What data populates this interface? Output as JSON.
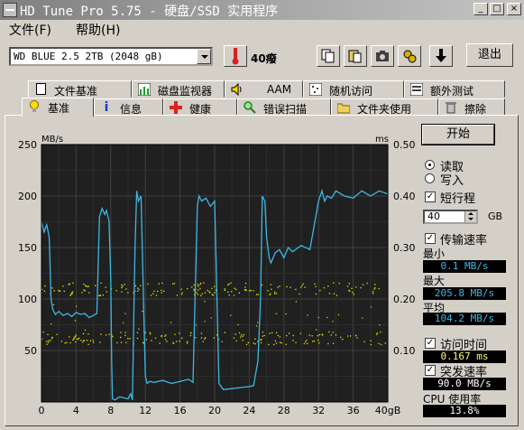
{
  "window": {
    "title": "HD Tune Pro 5.75 - 硬盘/SSD 实用程序",
    "minimize": "_",
    "maximize": "□",
    "close": "×"
  },
  "menu": {
    "file": "文件(F)",
    "help": "帮助(H)"
  },
  "toolbar": {
    "drive": "WD BLUE 2.5  2TB (2048 gB)",
    "temperature": "40癈",
    "exit": "退出"
  },
  "tabs_top": [
    {
      "label": "文件基准",
      "icon": "document-icon"
    },
    {
      "label": "磁盘监视器",
      "icon": "monitor-chart-icon"
    },
    {
      "label": "AAM",
      "icon": "speaker-icon"
    },
    {
      "label": "随机访问",
      "icon": "random-access-icon"
    },
    {
      "label": "额外测试",
      "icon": "extra-tests-icon"
    }
  ],
  "tabs_bottom": [
    {
      "label": "基准",
      "icon": "lightbulb-icon"
    },
    {
      "label": "信息",
      "icon": "info-icon"
    },
    {
      "label": "健康",
      "icon": "health-cross-icon"
    },
    {
      "label": "错误扫描",
      "icon": "magnifier-icon"
    },
    {
      "label": "文件夹使用",
      "icon": "folder-icon"
    },
    {
      "label": "擦除",
      "icon": "trash-icon"
    }
  ],
  "side": {
    "start": "开始",
    "read": "读取",
    "write": "写入",
    "short_stroke": "短行程",
    "short_stroke_value": "40",
    "short_stroke_unit": "GB",
    "transfer_rate": "传输速率",
    "min_label": "最小",
    "min_value": "0.1 MB/s",
    "max_label": "最大",
    "max_value": "205.8 MB/s",
    "avg_label": "平均",
    "avg_value": "104.2 MB/s",
    "access_time": "访问时间",
    "access_value": "0.167 ms",
    "burst_rate": "突发速率",
    "burst_value": "90.0 MB/s",
    "cpu_label": "CPU 使用率",
    "cpu_value": "13.8%"
  },
  "colors": {
    "transfer_line": "#3fb7e6",
    "access_dots": "#e8e800",
    "chart_bg": "#202020",
    "grid": "#404040",
    "value_text": "#ffff80"
  },
  "chart_data": {
    "type": "line",
    "y_left_label": "MB/s",
    "y_right_label": "ms",
    "y_left_ticks": [
      "50",
      "100",
      "150",
      "200",
      "250"
    ],
    "y_right_ticks": [
      "0.10",
      "0.20",
      "0.30",
      "0.40",
      "0.50"
    ],
    "x_ticks": [
      "0",
      "4",
      "8",
      "12",
      "16",
      "20",
      "24",
      "28",
      "32",
      "36",
      "40gB"
    ],
    "xlim": [
      0,
      40
    ],
    "ylim_left": [
      0,
      250
    ],
    "ylim_right": [
      0,
      0.5
    ],
    "series": [
      {
        "x": [
          0,
          0.3,
          0.6,
          0.9,
          1.1,
          1.3,
          1.6,
          2.0,
          2.5,
          3.0,
          3.5,
          4.0,
          4.5,
          5.0,
          5.5,
          6.0,
          6.4,
          6.7,
          7.0,
          7.3,
          7.5,
          7.8,
          8.0,
          8.1,
          8.2,
          8.5,
          9.0,
          9.5,
          10.0,
          10.3,
          10.5,
          10.8,
          11.0,
          11.2,
          11.5,
          11.8,
          12.0,
          12.2,
          12.5,
          13.0,
          14.0,
          15.0,
          16.0,
          17.0,
          17.5,
          18.0,
          18.2,
          18.5,
          19.0,
          19.5,
          20.0,
          20.5,
          21.0,
          22.0,
          23.0,
          24.0,
          24.5,
          25.0,
          25.3,
          25.5,
          25.8,
          26.0,
          26.3,
          26.5,
          27.0,
          27.5,
          28.0,
          28.5,
          29.0,
          30.0,
          31.0,
          32.0,
          32.4,
          32.7,
          33.0,
          33.5,
          34.0,
          35.0,
          36.0,
          37.0,
          38.0,
          39.0,
          40.0
        ],
        "y": [
          175,
          165,
          172,
          160,
          100,
          90,
          85,
          88,
          84,
          86,
          83,
          87,
          85,
          86,
          82,
          84,
          86,
          180,
          188,
          182,
          186,
          176,
          120,
          40,
          3,
          2,
          5,
          4,
          3,
          8,
          2,
          150,
          205,
          195,
          200,
          92,
          25,
          18,
          20,
          19,
          21,
          18,
          20,
          22,
          19,
          190,
          200,
          195,
          198,
          190,
          195,
          18,
          12,
          13,
          14,
          15,
          16,
          40,
          100,
          200,
          195,
          160,
          140,
          135,
          145,
          148,
          140,
          150,
          146,
          152,
          148,
          195,
          205,
          195,
          200,
          198,
          205,
          200,
          198,
          205,
          200,
          205,
          202
        ]
      }
    ],
    "access_time_bands_ms": [
      0.22,
      0.125
    ],
    "access_time_min_label": "0.167 ms"
  }
}
